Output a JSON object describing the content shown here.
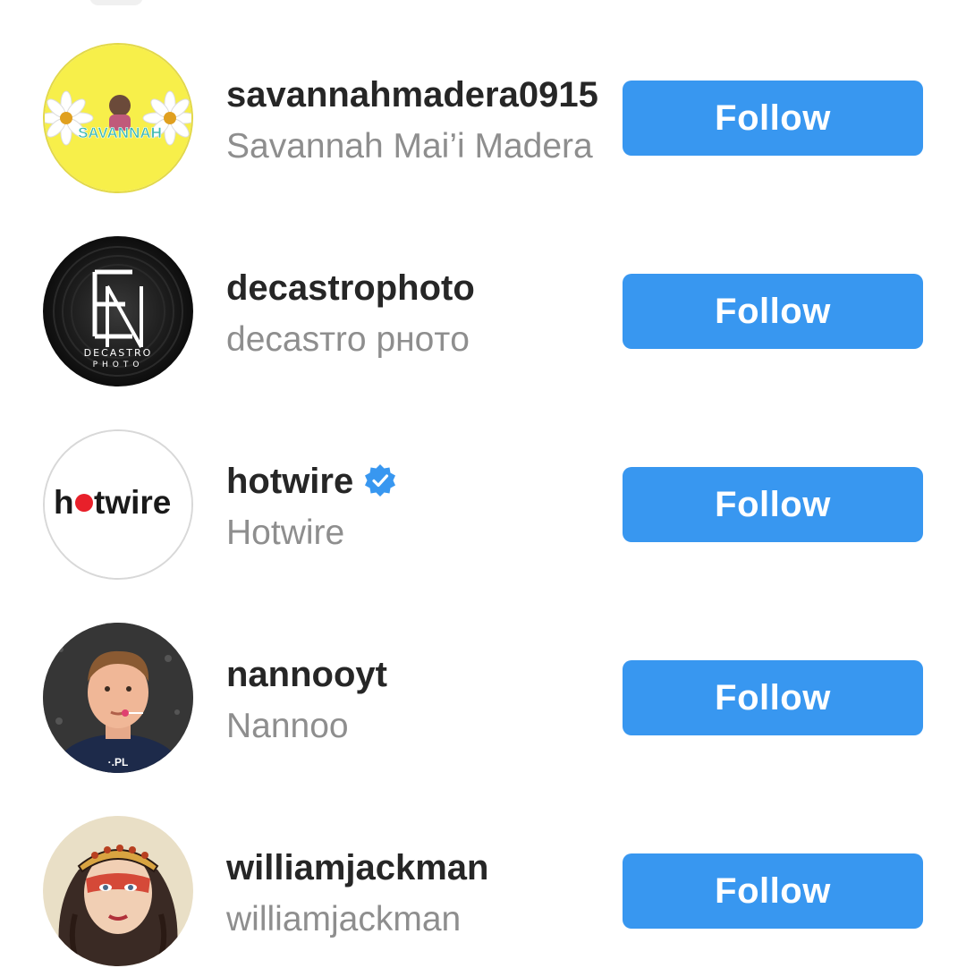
{
  "suggestions": [
    {
      "username": "savannahmadera0915",
      "full_name": "Savannah Mai’i Madera",
      "verified": false,
      "follow_label": "Follow",
      "avatar": "savannah-avatar-icon",
      "avatar_text": "SAVANNAH"
    },
    {
      "username": "decastrophoto",
      "full_name": "decasтro pнoтo",
      "verified": false,
      "follow_label": "Follow",
      "avatar": "decastro-logo-icon",
      "avatar_text": "DECASTRO PHOTO"
    },
    {
      "username": "hotwire",
      "full_name": "Hotwire",
      "verified": true,
      "follow_label": "Follow",
      "avatar": "hotwire-logo-icon",
      "avatar_text": "hotwire"
    },
    {
      "username": "nannooyt",
      "full_name": "Nannoo",
      "verified": false,
      "follow_label": "Follow",
      "avatar": "boy-portrait-icon"
    },
    {
      "username": "williamjackman",
      "full_name": "williamjackman",
      "verified": false,
      "follow_label": "Follow",
      "avatar": "tattoo-art-icon"
    }
  ],
  "colors": {
    "follow_button": "#3897f0",
    "username": "#262626",
    "full_name": "#8e8e8e",
    "verified_badge": "#3897f0"
  }
}
